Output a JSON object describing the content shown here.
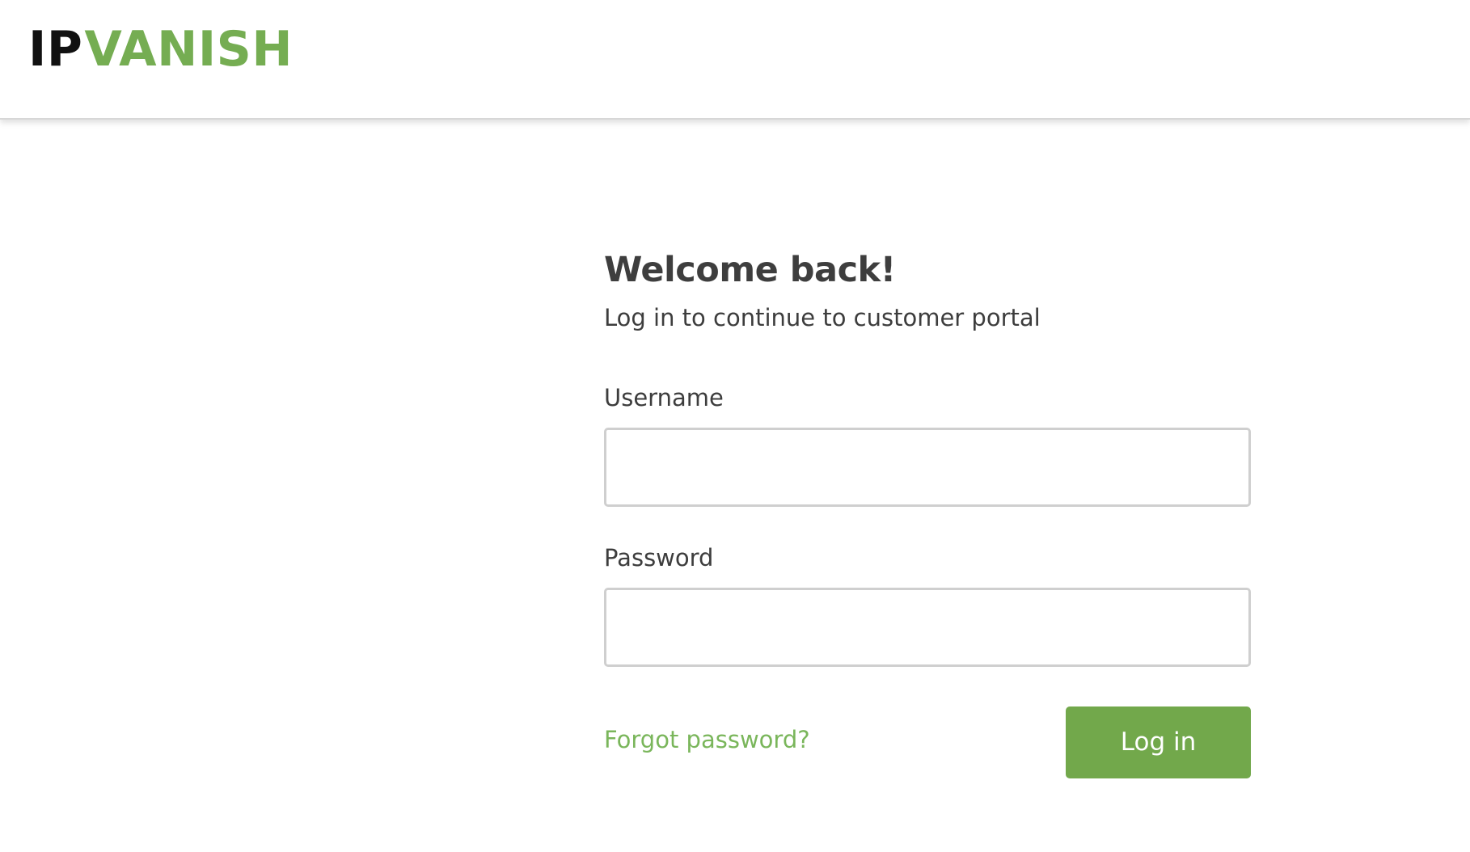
{
  "brand": {
    "logo_part_1": "IP",
    "logo_part_2": "VANISH",
    "primary_color": "#111111",
    "accent_color": "#75ad52"
  },
  "login": {
    "title": "Welcome back!",
    "subtitle": "Log in to continue to customer portal",
    "username_label": "Username",
    "username_value": "",
    "username_placeholder": "",
    "password_label": "Password",
    "password_value": "",
    "password_placeholder": "",
    "forgot_password_text": "Forgot password?",
    "login_button_text": "Log in"
  },
  "colors": {
    "text": "#3f3f3f",
    "input_border": "#cfcfcf",
    "link": "#7ab65b",
    "button": "#72a84b"
  }
}
